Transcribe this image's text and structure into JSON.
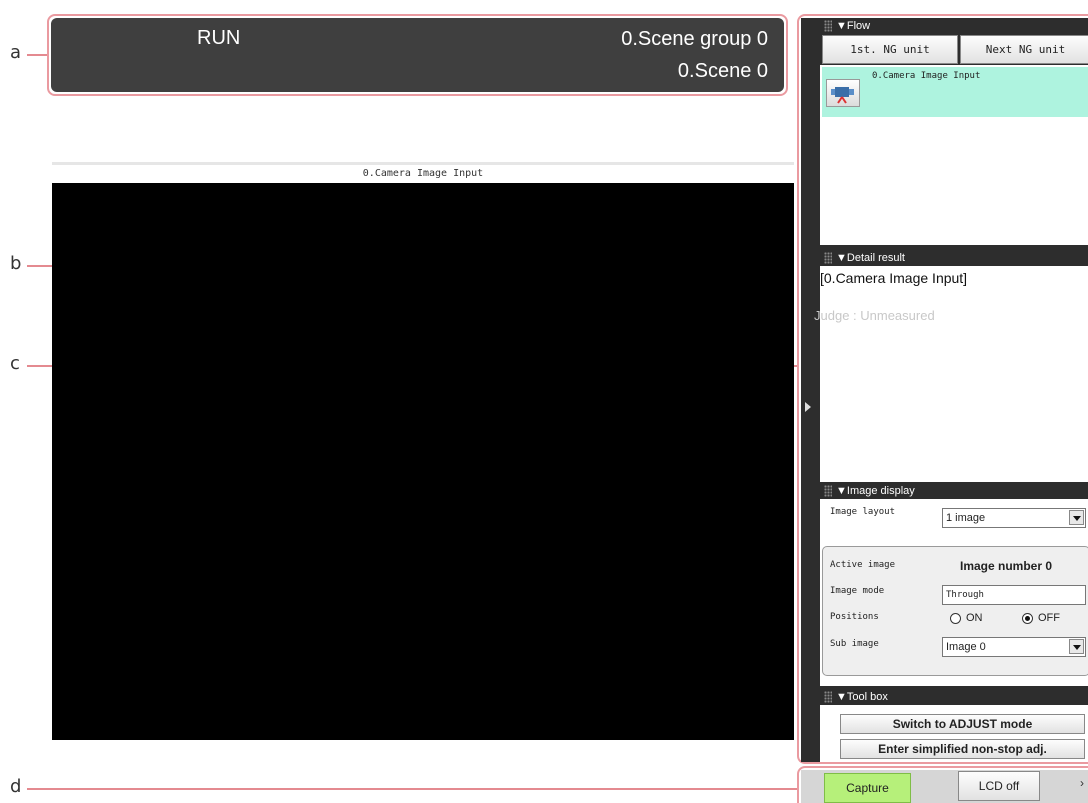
{
  "callouts": {
    "a": "a",
    "b": "b",
    "c": "c",
    "d": "d"
  },
  "status": {
    "mode": "RUN",
    "scene_group": "0.Scene group 0",
    "scene": "0.Scene 0"
  },
  "image_pane": {
    "title": "0.Camera Image Input"
  },
  "flow": {
    "header": "▼Flow",
    "first_ng_button": "1st. NG unit",
    "next_ng_button": "Next NG unit",
    "items": [
      {
        "label": "0.Camera Image Input"
      }
    ]
  },
  "detail": {
    "header": "▼Detail result",
    "title": "[0.Camera Image Input]",
    "judge": "Judge : Unmeasured"
  },
  "image_display": {
    "header": "▼Image display",
    "layout_label": "Image layout",
    "layout_value": "1 image",
    "active_label": "Active image",
    "active_value": "Image number 0",
    "mode_label": "Image mode",
    "mode_value": "Through",
    "positions_label": "Positions",
    "positions_on": "ON",
    "positions_off": "OFF",
    "positions_selected": "OFF",
    "sub_label": "Sub image",
    "sub_value": "Image 0"
  },
  "toolbox": {
    "header": "▼Tool box",
    "adjust_button": "Switch to ADJUST mode",
    "nonstop_button": "Enter simplified non-stop adj."
  },
  "bottom": {
    "capture_button": "Capture",
    "lcd_button": "LCD off"
  },
  "colors": {
    "status_bar": "#3f3f3f",
    "panel": "#2d2d2d",
    "flow_item_selected": "#aef3df",
    "capture_button": "#b6f07a",
    "callout": "#e48a90"
  }
}
